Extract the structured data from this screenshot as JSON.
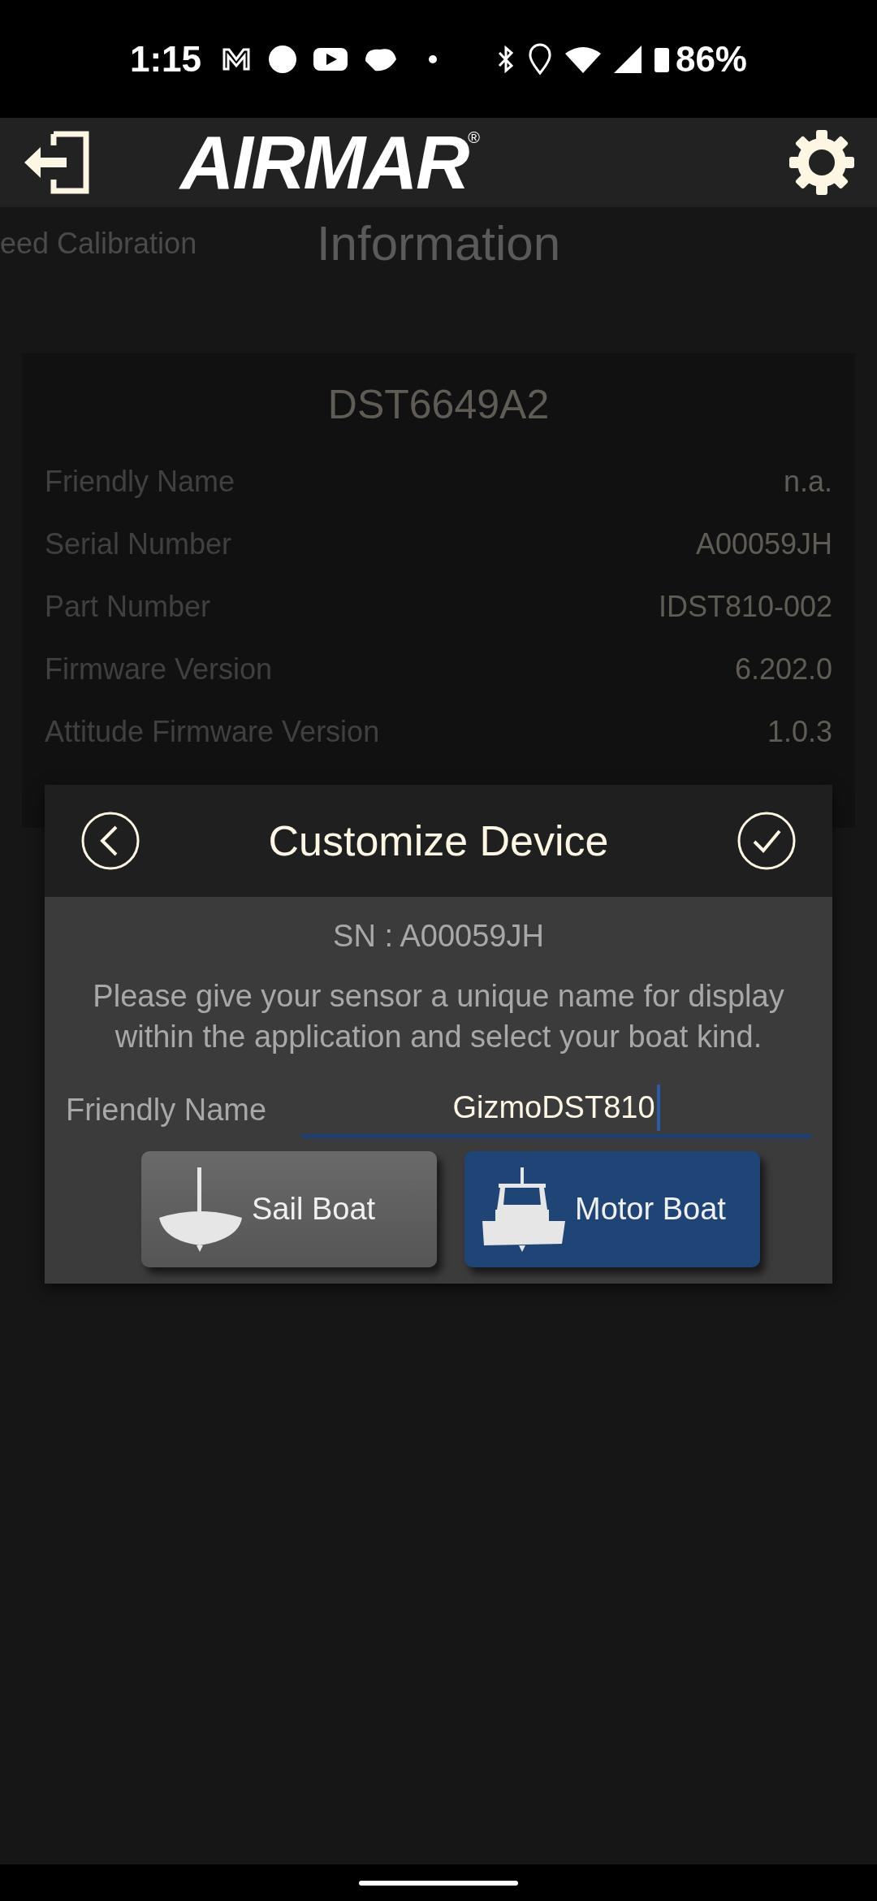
{
  "status_bar": {
    "time": "1:15",
    "battery": "86%"
  },
  "app_bar": {
    "logo": "AIRMAR",
    "logo_mark": "®"
  },
  "pages": [
    {
      "label": "eed Calibration",
      "selected": false
    },
    {
      "label": "Information",
      "selected": true
    }
  ],
  "device_card": {
    "title": "DST6649A2",
    "rows": [
      {
        "label": "Friendly Name",
        "value": "n.a."
      },
      {
        "label": "Serial Number",
        "value": "A00059JH"
      },
      {
        "label": "Part Number",
        "value": "IDST810-002"
      },
      {
        "label": "Firmware Version",
        "value": "6.202.0"
      },
      {
        "label": "Attitude Firmware Version",
        "value": "1.0.3"
      }
    ]
  },
  "dialog": {
    "title": "Customize Device",
    "serial": "SN : A00059JH",
    "message": "Please give your sensor a unique name for display within the application and select your boat kind.",
    "field_label": "Friendly Name",
    "field_value": "GizmoDST810",
    "boat_kinds": [
      {
        "kind": "sail",
        "label": "Sail Boat",
        "selected": false
      },
      {
        "kind": "motor",
        "label": "Motor Boat",
        "selected": true
      }
    ]
  }
}
